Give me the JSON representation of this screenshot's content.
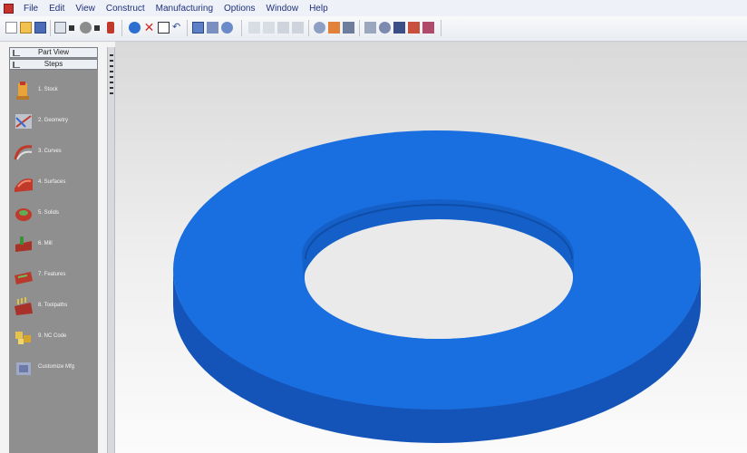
{
  "menu": {
    "items": [
      "File",
      "Edit",
      "View",
      "Construct",
      "Manufacturing",
      "Options",
      "Window",
      "Help"
    ]
  },
  "panel": {
    "tabs": [
      "Part View",
      "Steps"
    ],
    "steps": [
      {
        "label": "1. Stock",
        "icon": "stock-icon"
      },
      {
        "label": "2. Geometry",
        "icon": "geometry-icon"
      },
      {
        "label": "3. Curves",
        "icon": "curves-icon"
      },
      {
        "label": "4. Surfaces",
        "icon": "surfaces-icon"
      },
      {
        "label": "5. Solids",
        "icon": "solids-icon"
      },
      {
        "label": "6. Mill",
        "icon": "mill-icon"
      },
      {
        "label": "7. Features",
        "icon": "features-icon"
      },
      {
        "label": "8. Toolpaths",
        "icon": "toolpaths-icon"
      },
      {
        "label": "9. NC Code",
        "icon": "nc-code-icon"
      },
      {
        "label": "Customize Mfg",
        "icon": "customize-icon"
      }
    ]
  },
  "model": {
    "color": "#1a6fe0",
    "side_color": "#1454b8",
    "description_icon": "washer-ring"
  },
  "colors": {
    "panel_bg": "#8f8f8f",
    "menu_text": "#1f2f7a"
  }
}
